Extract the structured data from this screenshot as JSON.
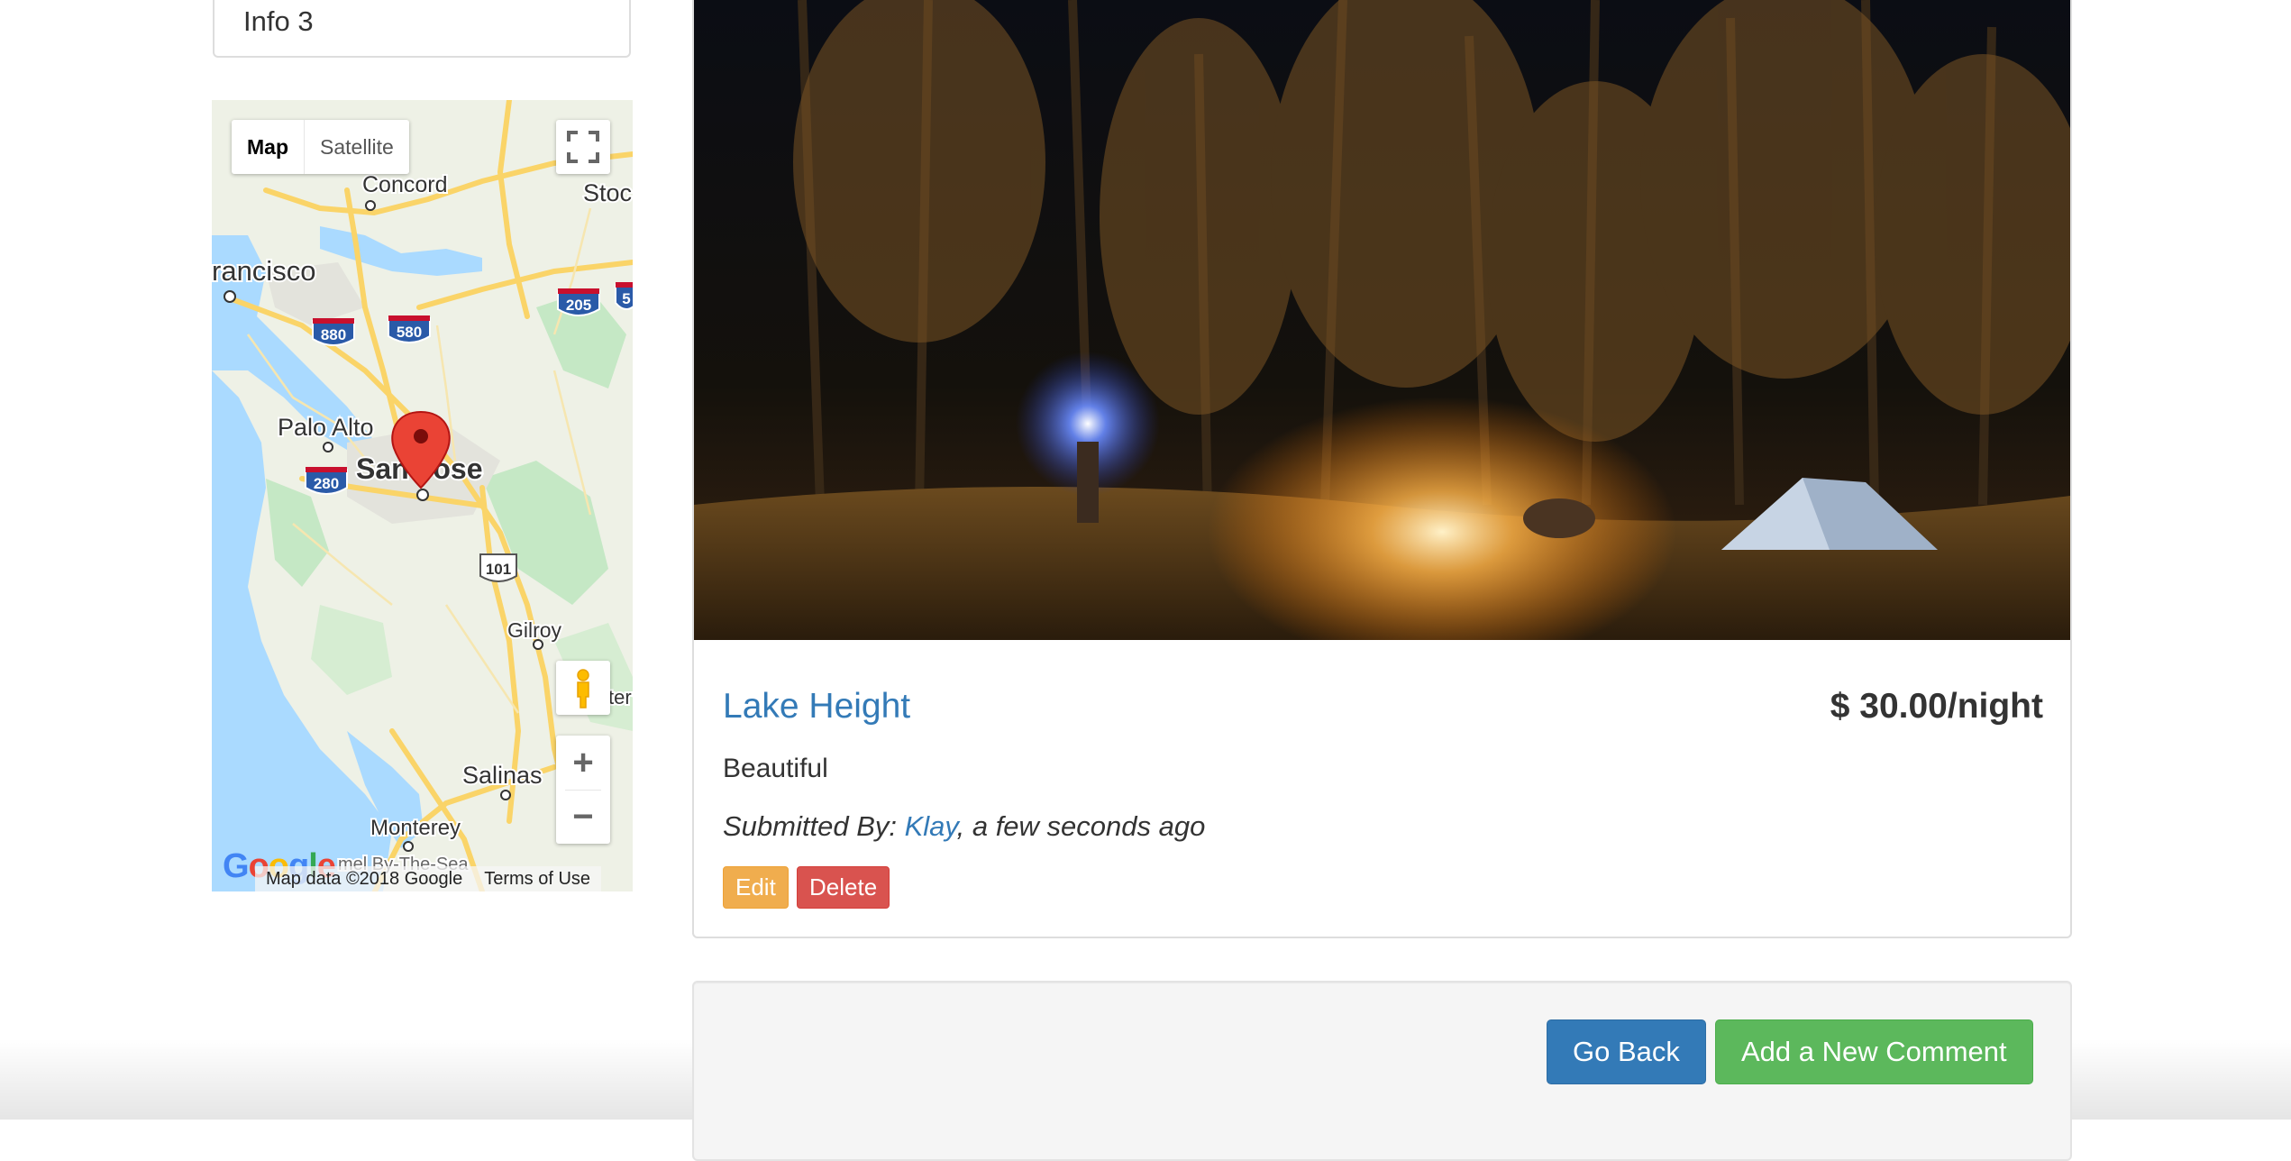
{
  "sidebar": {
    "info_item": "Info 3"
  },
  "map": {
    "type_buttons": {
      "map": "Map",
      "satellite": "Satellite"
    },
    "labels": {
      "concord": "Concord",
      "stockton": "Stoc",
      "san_francisco": "rancisco",
      "palo_alto": "Palo Alto",
      "san_jose": "San Jose",
      "gilroy": "Gilroy",
      "salinas": "Salinas",
      "monterey": "Monterey",
      "tracy": "ter",
      "pebble": "mel By-The-Sea"
    },
    "shields": {
      "i880": "880",
      "i580": "580",
      "i205": "205",
      "i280": "280",
      "us101": "101",
      "i5": "5"
    },
    "zoom_in": "+",
    "zoom_out": "−",
    "attribution": "Map data ©2018 Google",
    "terms": "Terms of Use",
    "logo": "Google",
    "colors": {
      "water": "#aadaff",
      "land": "#eef1e6",
      "road": "#fad468",
      "park": "#c5e8c5",
      "pin": "#ea4335"
    }
  },
  "campground": {
    "name": "Lake Height",
    "price": "$ 30.00/night",
    "description": "Beautiful",
    "submitted_prefix": "Submitted By: ",
    "author": "Klay",
    "submitted_suffix": ", a few seconds ago",
    "edit_label": "Edit",
    "delete_label": "Delete"
  },
  "actions": {
    "go_back_label": "Go Back",
    "add_comment_label": "Add a New Comment"
  },
  "colors": {
    "link": "#337ab7",
    "warning": "#f0ad4e",
    "danger": "#d9534f",
    "primary": "#337ab7",
    "success": "#5cb85c"
  }
}
